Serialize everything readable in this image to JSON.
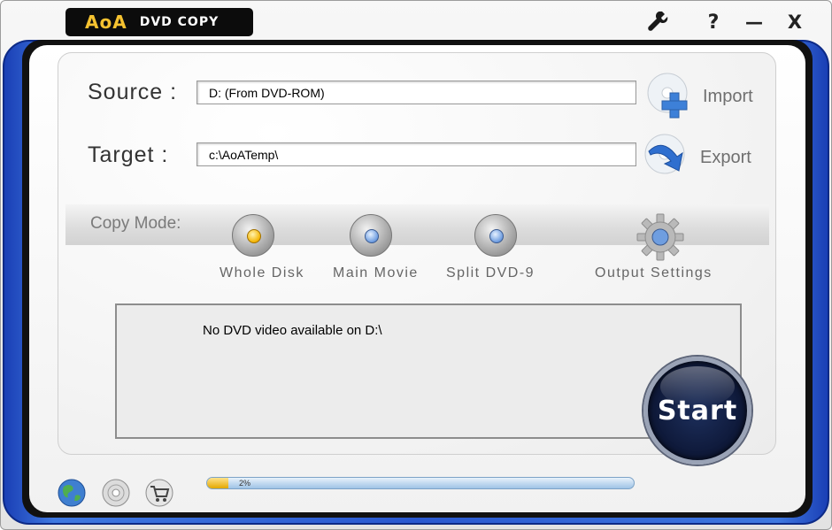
{
  "app": {
    "logo_brand": "AoA",
    "logo_product": "DVD COPY"
  },
  "titlebar": {
    "help_label": "?",
    "minimize_label": "—",
    "close_label": "X",
    "icons": [
      "wrench-icon"
    ]
  },
  "source": {
    "label": "Source :",
    "value": "D:  (From DVD-ROM)",
    "button_label": "Import",
    "button_icon": "plus-disc-icon"
  },
  "target": {
    "label": "Target :",
    "value": "c:\\AoATemp\\",
    "button_label": "Export",
    "button_icon": "arrow-disc-icon"
  },
  "copy_mode": {
    "label": "Copy Mode:",
    "options": [
      {
        "label": "Whole Disk",
        "selected": true
      },
      {
        "label": "Main Movie",
        "selected": false
      },
      {
        "label": "Split DVD-9",
        "selected": false
      }
    ],
    "output_settings_label": "Output Settings"
  },
  "status": {
    "message": "No DVD video available on D:\\"
  },
  "start_label": "Start",
  "progress": {
    "value": 0.05,
    "text": "2%"
  },
  "bottom_icons": [
    "globe-icon",
    "disc-icon",
    "cart-icon"
  ],
  "colors": {
    "frame_blue": "#2a58cf",
    "selected_radio": "#f4b400",
    "unselected_radio": "#6d9ce0",
    "start_button": "#0f1a3b"
  }
}
